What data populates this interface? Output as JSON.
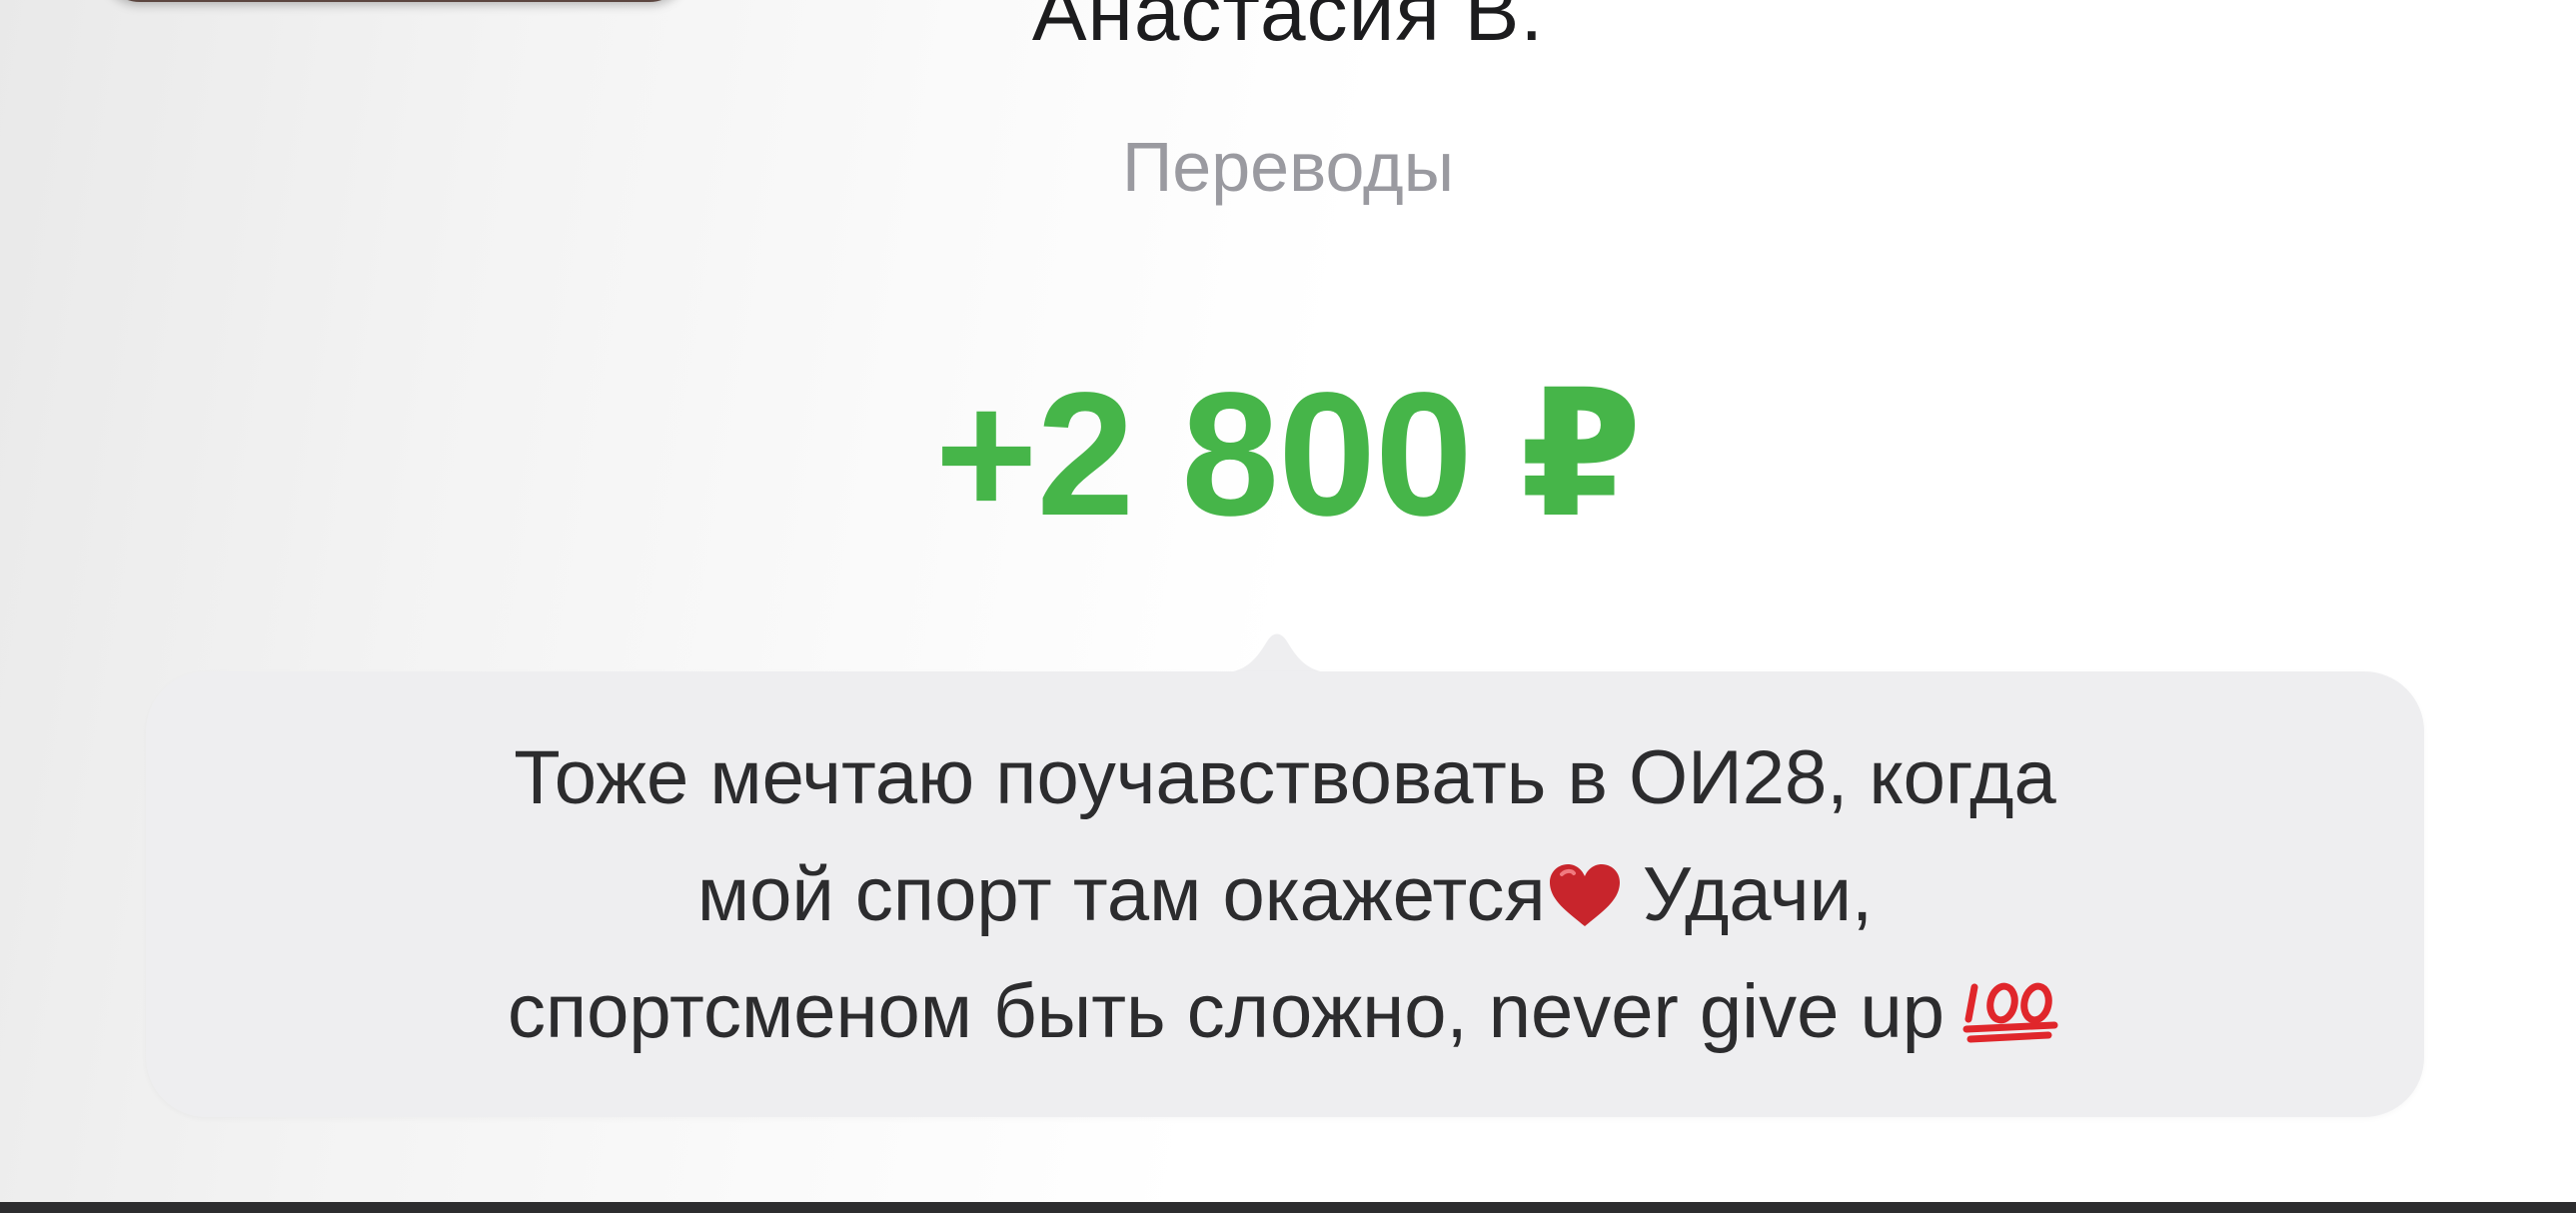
{
  "contact": {
    "name": "Анастасия В.",
    "category": "Переводы"
  },
  "transaction": {
    "amount": "+2 800 ₽",
    "amount_color": "#46b549"
  },
  "message": {
    "line1": "Тоже мечтаю поучавствовать в ОИ28, когда",
    "line2": "мой спорт там окажется",
    "line2_after": "Удачи,",
    "line3": "спортсменом быть сложно, never give up",
    "icons": [
      "heart-icon",
      "hundred-points-icon"
    ]
  }
}
